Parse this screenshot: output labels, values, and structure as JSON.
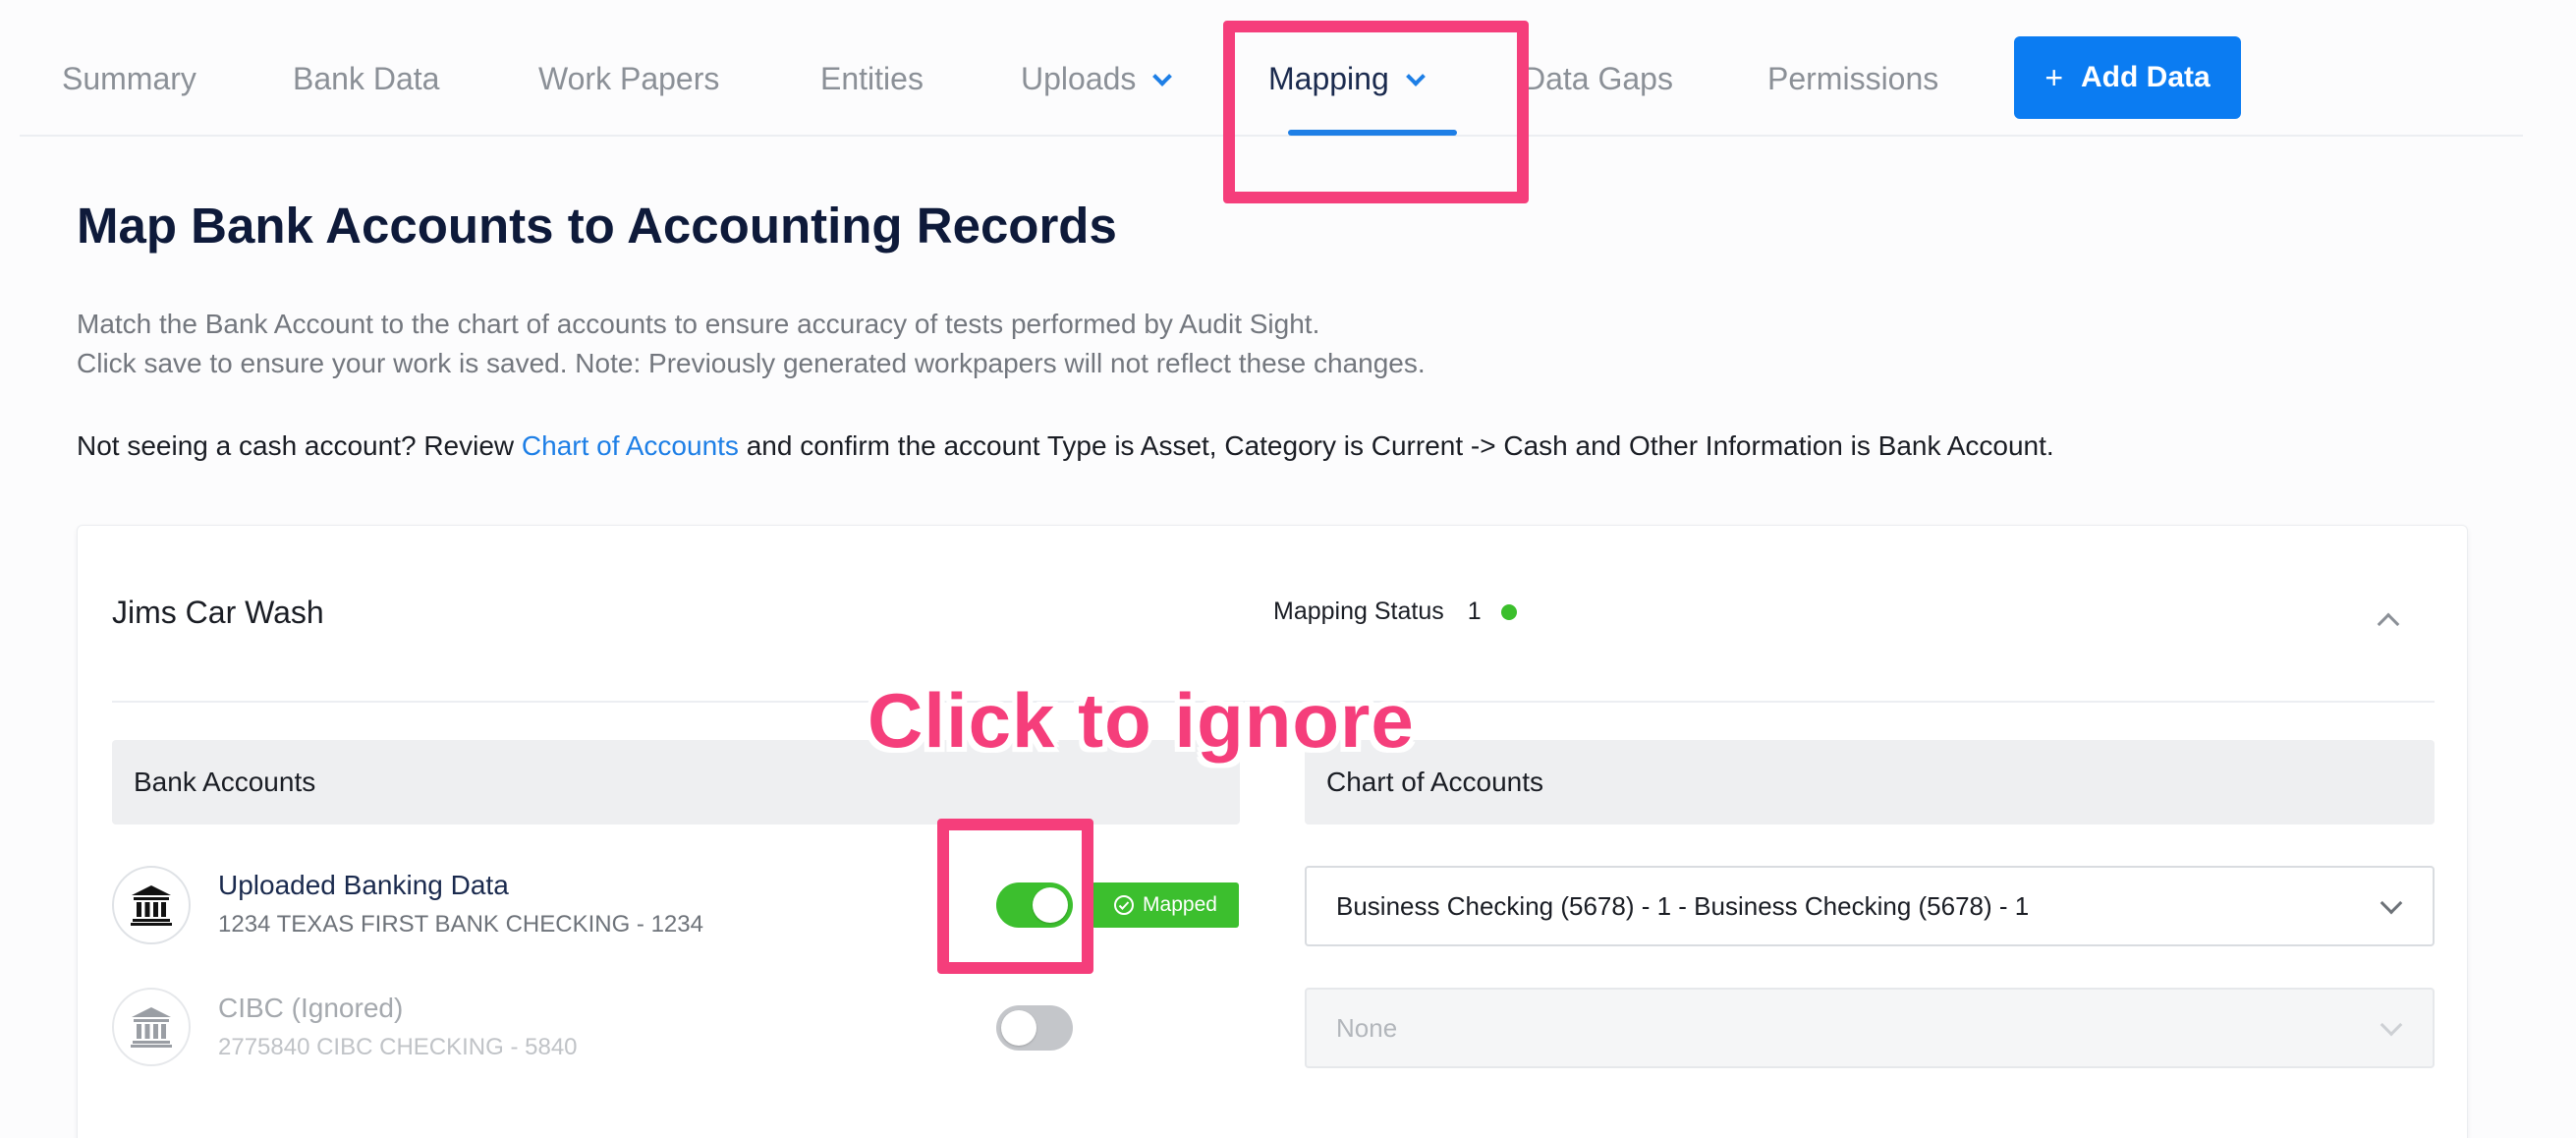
{
  "nav": {
    "items": [
      {
        "label": "Summary"
      },
      {
        "label": "Bank Data"
      },
      {
        "label": "Work Papers"
      },
      {
        "label": "Entities"
      },
      {
        "label": "Uploads"
      },
      {
        "label": "Mapping"
      },
      {
        "label": "Data Gaps"
      },
      {
        "label": "Permissions"
      }
    ],
    "add_button": {
      "plus": "+",
      "label": "Add Data"
    }
  },
  "header": {
    "title": "Map Bank Accounts to Accounting Records",
    "desc_line1": "Match the Bank Account to the chart of accounts to ensure accuracy of tests performed by Audit Sight.",
    "desc_line2": "Click save to ensure your work is saved. Note: Previously generated workpapers will not reflect these changes.",
    "note_before": "Not seeing a cash account? Review ",
    "note_link": "Chart of Accounts",
    "note_after": " and confirm the account Type is Asset, Category is Current -> Cash and Other Information is Bank Account."
  },
  "card": {
    "entity_name": "Jims Car Wash",
    "status_label": "Mapping Status",
    "status_count": "1",
    "col_bank": "Bank Accounts",
    "col_chart": "Chart of Accounts",
    "rows": [
      {
        "title": "Uploaded Banking Data",
        "subtitle": "1234 TEXAS FIRST BANK CHECKING - 1234",
        "badge": "Mapped",
        "select_value": "Business Checking (5678) - 1 - Business Checking (5678) - 1"
      },
      {
        "title": "CIBC (Ignored)",
        "subtitle": "2775840 CIBC CHECKING - 5840",
        "select_value": "None"
      }
    ]
  },
  "annotation": {
    "text": "Click to ignore"
  },
  "colors": {
    "accent": "#1e7fe6",
    "success": "#3cbf2e",
    "highlight": "#f53e7b"
  }
}
